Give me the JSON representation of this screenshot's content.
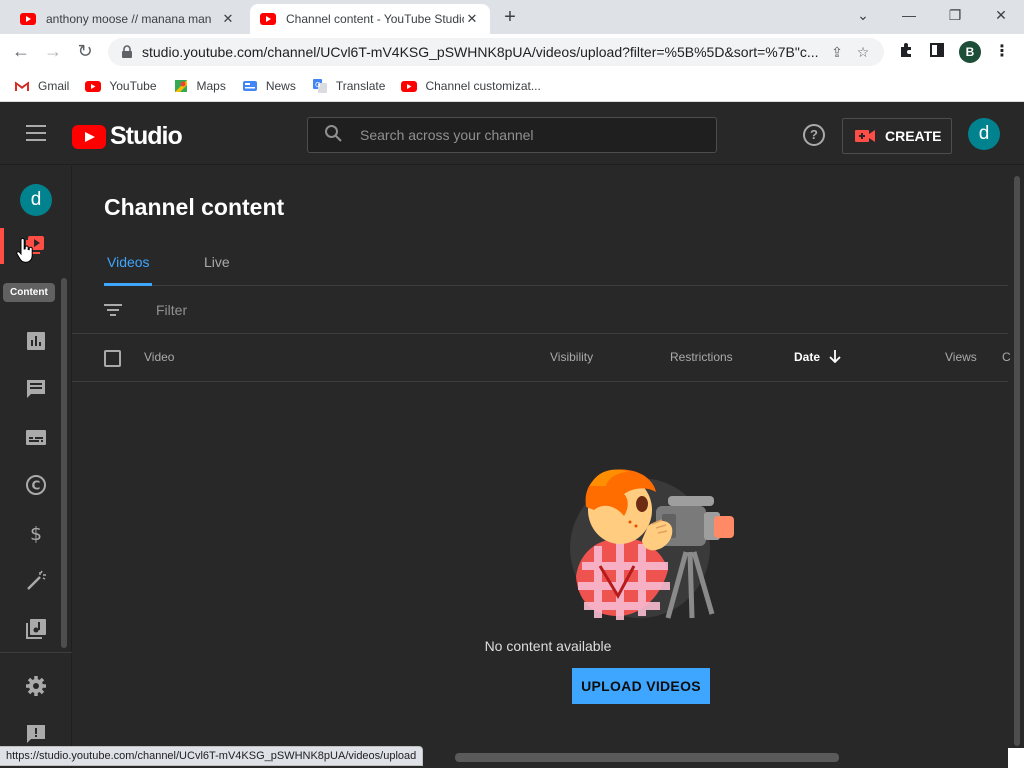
{
  "browser": {
    "tabs": [
      {
        "title": "anthony moose // manana man",
        "active": false
      },
      {
        "title": "Channel content - YouTube Studio",
        "active": true
      }
    ],
    "url": "studio.youtube.com/channel/UCvl6T-mV4KSG_pSWHNK8pUA/videos/upload?filter=%5B%5D&sort=%7B\"c...",
    "profile_initial": "B",
    "bookmarks": [
      {
        "label": "Gmail",
        "icon": "gmail-icon"
      },
      {
        "label": "YouTube",
        "icon": "youtube-icon"
      },
      {
        "label": "Maps",
        "icon": "maps-icon"
      },
      {
        "label": "News",
        "icon": "news-icon"
      },
      {
        "label": "Translate",
        "icon": "translate-icon"
      },
      {
        "label": "Channel customizat...",
        "icon": "youtube-icon"
      }
    ],
    "status_url": "https://studio.youtube.com/channel/UCvl6T-mV4KSG_pSWHNK8pUA/videos/upload"
  },
  "header": {
    "logo_text": "Studio",
    "search_placeholder": "Search across your channel",
    "create_label": "CREATE",
    "avatar_initial": "d"
  },
  "sidebar": {
    "avatar_initial": "d",
    "tooltip": "Content",
    "items": [
      {
        "name": "content",
        "icon": "content-icon",
        "active": true
      },
      {
        "name": "analytics",
        "icon": "analytics-icon"
      },
      {
        "name": "comments",
        "icon": "comments-icon"
      },
      {
        "name": "subtitles",
        "icon": "subtitles-icon"
      },
      {
        "name": "copyright",
        "icon": "copyright-icon"
      },
      {
        "name": "earn",
        "icon": "dollar-icon"
      },
      {
        "name": "customization",
        "icon": "magic-wand-icon"
      },
      {
        "name": "audio-library",
        "icon": "audio-library-icon"
      },
      {
        "name": "settings",
        "icon": "gear-icon"
      },
      {
        "name": "feedback",
        "icon": "feedback-icon"
      }
    ]
  },
  "main": {
    "title": "Channel content",
    "tabs": [
      {
        "label": "Videos",
        "selected": true
      },
      {
        "label": "Live",
        "selected": false
      }
    ],
    "filter_placeholder": "Filter",
    "columns": [
      "Video",
      "Visibility",
      "Restrictions",
      "Date",
      "Views",
      "C"
    ],
    "sort_column": "Date",
    "empty_text": "No content available",
    "upload_label": "UPLOAD VIDEOS"
  },
  "colors": {
    "accent_blue": "#3ea6ff",
    "youtube_red": "#ff0000",
    "background": "#282828",
    "avatar_teal": "#00838f"
  }
}
